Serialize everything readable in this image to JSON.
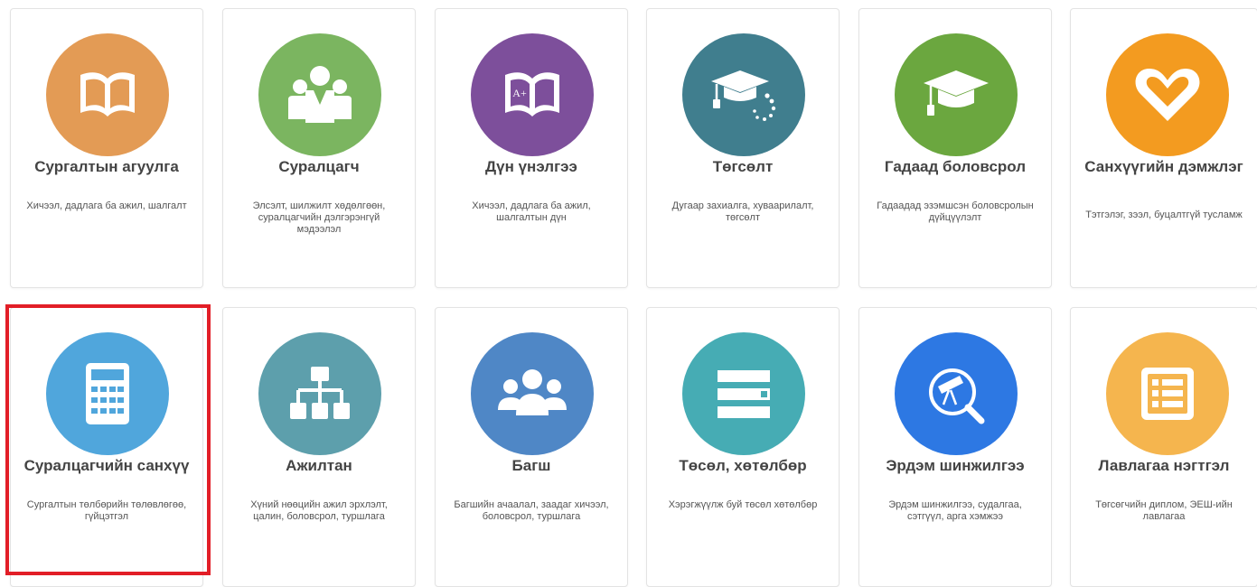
{
  "tiles": [
    {
      "title": "Сургалтын агуулга",
      "desc": "Хичээл, дадлага ба ажил, шалгалт",
      "icon": "open-book-icon",
      "color": "#e39b55"
    },
    {
      "title": "Суралцагч",
      "desc": "Элсэлт, шилжилт хөдөлгөөн, суралцагчийн дэлгэрэнгүй мэдээлэл",
      "icon": "students-group-icon",
      "color": "#7bb560"
    },
    {
      "title": "Дүн үнэлгээ",
      "desc": "Хичээл, дадлага ба ажил, шалгалтын дүн",
      "icon": "grade-book-icon",
      "color": "#7d4f9b",
      "grade": "A+"
    },
    {
      "title": "Төгсөлт",
      "desc": "Дугаар захиалга, хуваарилалт, төгсөлт",
      "icon": "graduation-cap-loading-icon",
      "color": "#407e8e"
    },
    {
      "title": "Гадаад боловсрол",
      "desc": "Гадаадад эзэмшсэн боловсролын дүйцүүлэлт",
      "icon": "graduation-cap-icon",
      "color": "#6ba73f"
    },
    {
      "title": "Санхүүгийн дэмжлэг",
      "desc": "Тэтгэлэг, зээл, буцалтгүй тусламж",
      "icon": "heart-icon",
      "color": "#f39b20"
    },
    {
      "title": "Суралцагчийн санхүү",
      "desc": "Сургалтын төлбөрийн төлөвлөгөө, гүйцэтгэл",
      "icon": "calculator-icon",
      "color": "#50a6dc"
    },
    {
      "title": "Ажилтан",
      "desc": "Хүний нөөцийн ажил эрхлэлт, цалин, боловсрол, туршлага",
      "icon": "org-chart-icon",
      "color": "#5d9fac"
    },
    {
      "title": "Багш",
      "desc": "Багшийн ачаалал, заадаг хичээл, боловсрол, туршлага",
      "icon": "teachers-group-icon",
      "color": "#4f87c6"
    },
    {
      "title": "Төсөл, хөтөлбөр",
      "desc": "Хэрэгжүүлж буй төсөл хөтөлбөр",
      "icon": "list-bars-icon",
      "color": "#46acb4"
    },
    {
      "title": "Эрдэм шинжилгээ",
      "desc": "Эрдэм шинжилгээ, судалгаа, сэтгүүл, арга хэмжээ",
      "icon": "telescope-search-icon",
      "color": "#2d78e3"
    },
    {
      "title": "Лавлагаа нэгтгэл",
      "desc": "Төгсөгчийн диплом, ЭЕШ-ийн лавлагаа",
      "icon": "checklist-icon",
      "color": "#f5b54e"
    }
  ],
  "highlight_color": "#e21e27"
}
